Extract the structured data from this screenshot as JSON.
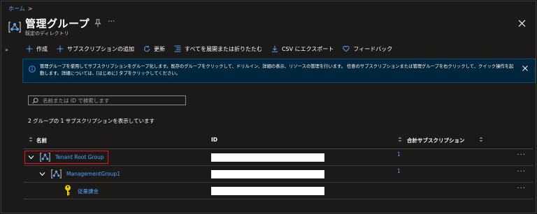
{
  "breadcrumb": {
    "home": "ホーム",
    "separator": ">"
  },
  "header": {
    "title": "管理グループ",
    "subtitle": "既定のディレクトリ",
    "more": "···",
    "expand": "»"
  },
  "toolbar": {
    "create": "作成",
    "add_subscription": "サブスクリプションの追加",
    "refresh": "更新",
    "expand_collapse": "すべてを展開または折りたたむ",
    "export_csv": "CSV にエクスポート",
    "feedback": "フィードバック"
  },
  "info": {
    "text": "管理グループを使用してサブスクリプションをグループ化します。既存のグループをクリックして、ドリルイン、詳細の表示、リソースの管理を行います。 任意のサブスクリプションまたは管理グループを右クリックして、クイック操作を起動します。詳細については、[はじめに] タブをクリックしてください。"
  },
  "search": {
    "placeholder": "名前または ID で検索します",
    "value": ""
  },
  "summary": "2 グループの 1 サブスクリプションを表示しています",
  "table": {
    "columns": {
      "name": "名前",
      "id": "ID",
      "total_subscriptions": "合計サブスクリプション"
    },
    "rows": [
      {
        "name": "Tenant Root Group",
        "count": "1",
        "more": "···"
      },
      {
        "name": "ManagementGroup1",
        "count": "1",
        "more": "···"
      },
      {
        "name": "従量課金",
        "count": "",
        "more": "···"
      }
    ]
  },
  "colors": {
    "accent": "#4fa3ff",
    "background": "#1b1a19",
    "info_bar": "#00263d",
    "highlight": "#e81123",
    "key_icon": "#f2c811"
  }
}
